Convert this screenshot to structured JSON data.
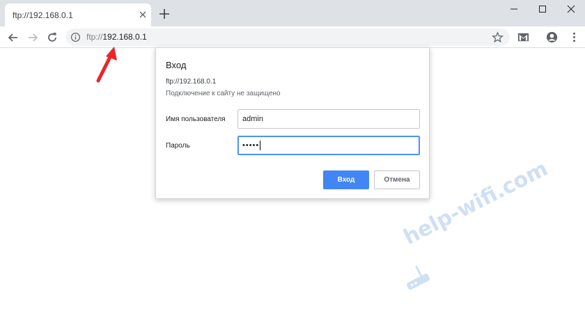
{
  "browser": {
    "tab": {
      "title": "ftp://192.168.0.1"
    },
    "address": {
      "scheme": "ftp://",
      "host": "192.168.0.1"
    }
  },
  "dialog": {
    "title": "Вход",
    "url": "ftp://192.168.0.1",
    "warning": "Подключение к сайту не защищено",
    "username": {
      "label": "Имя пользователя",
      "value": "admin"
    },
    "password": {
      "label": "Пароль",
      "masked_value": "•••••"
    },
    "login_label": "Вход",
    "cancel_label": "Отмена"
  },
  "watermark": {
    "text": "help-wifi.com"
  },
  "colors": {
    "accent": "#4285f4",
    "annotation": "#e8262a",
    "watermark": "#cfe0f5"
  },
  "icons": [
    "close-icon",
    "new-tab-icon",
    "minimize-icon",
    "maximize-icon",
    "window-close-icon",
    "back-icon",
    "forward-icon",
    "reload-icon",
    "info-icon",
    "bookmark-star-icon",
    "gmail-icon",
    "profile-icon",
    "menu-icon"
  ]
}
